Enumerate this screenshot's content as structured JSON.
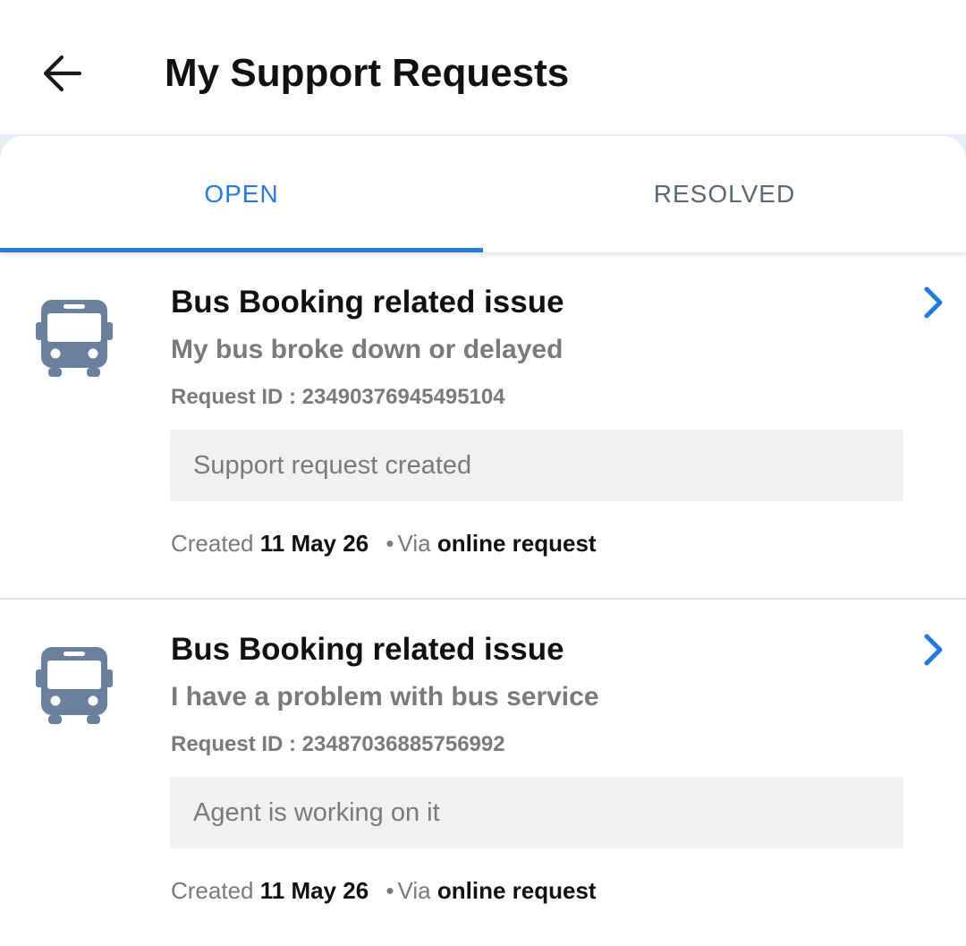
{
  "header": {
    "title": "My Support Requests",
    "back_icon": "arrow-left-icon"
  },
  "tabs": [
    {
      "label": "OPEN",
      "active": true
    },
    {
      "label": "RESOLVED",
      "active": false
    }
  ],
  "colors": {
    "accent": "#2d7ad6",
    "icon": "#6b7f9f",
    "chevron": "#1f7ae0"
  },
  "requests": [
    {
      "icon": "bus-icon",
      "category": "Bus Booking related issue",
      "issue": "My bus broke down or delayed",
      "request_id_label": "Request ID : 23490376945495104",
      "status": "Support request created",
      "created_label": "Created",
      "created_date": "11 May 26",
      "via_label": "Via",
      "channel": "online request"
    },
    {
      "icon": "bus-icon",
      "category": "Bus Booking related issue",
      "issue": "I have a problem with bus service",
      "request_id_label": "Request ID : 23487036885756992",
      "status": "Agent is working on it",
      "created_label": "Created",
      "created_date": "11 May 26",
      "via_label": "Via",
      "channel": "online request"
    }
  ]
}
